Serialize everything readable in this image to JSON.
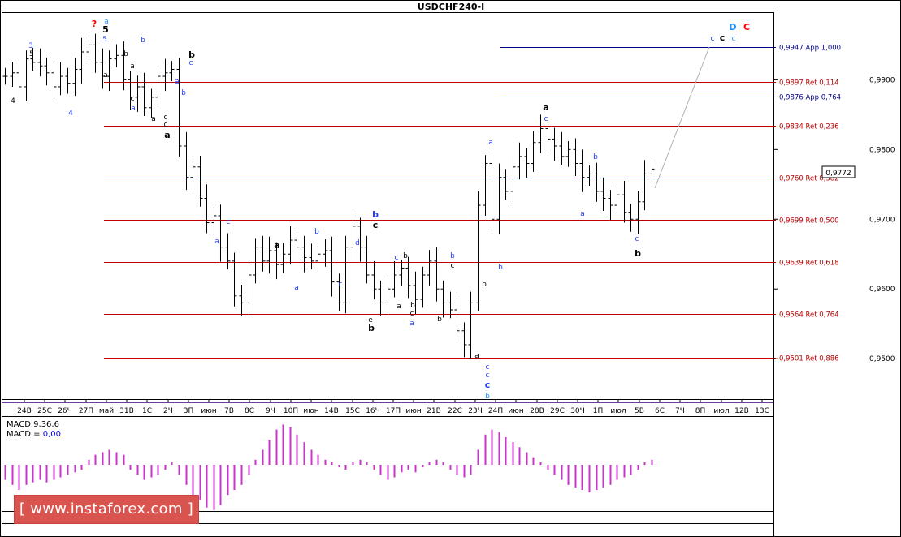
{
  "chart_data": {
    "type": "ohlc",
    "symbol": "USDCHF240-I",
    "ylim": [
      0.9442,
      0.9997
    ],
    "y_ticks": [
      "0,9900",
      "0,9800",
      "0,9700",
      "0,9600",
      "0,9500"
    ],
    "y_tick_values": [
      0.99,
      0.98,
      0.97,
      0.96,
      0.95
    ],
    "x_ticks": [
      "24В",
      "25С",
      "26Ч",
      "27П",
      "май",
      "31В",
      "1С",
      "2Ч",
      "3П",
      "июн",
      "7В",
      "8С",
      "9Ч",
      "10П",
      "июн",
      "14В",
      "15С",
      "16Ч",
      "17П",
      "июн",
      "21В",
      "22С",
      "23Ч",
      "24П",
      "июн",
      "28В",
      "29С",
      "30Ч",
      "1П",
      "июл",
      "5В",
      "6С",
      "7Ч",
      "8П",
      "июл",
      "12В",
      "13С"
    ],
    "current_price": "0,9772",
    "levels": [
      {
        "label": "0,9947 App 1,000",
        "value": 0.9947,
        "kind": "app",
        "color": "#00008b"
      },
      {
        "label": "0,9897 Ret 0,114",
        "value": 0.9897,
        "kind": "ret",
        "color": "#c00000"
      },
      {
        "label": "0,9876 App 0,764",
        "value": 0.9876,
        "kind": "app",
        "color": "#00008b"
      },
      {
        "label": "0,9834 Ret 0,236",
        "value": 0.9834,
        "kind": "ret",
        "color": "#c00000"
      },
      {
        "label": "0,9760 Ret 0,382",
        "value": 0.976,
        "kind": "ret",
        "color": "#c00000"
      },
      {
        "label": "0,9699 Ret 0,500",
        "value": 0.9699,
        "kind": "ret",
        "color": "#c00000"
      },
      {
        "label": "0,9639 Ret 0,618",
        "value": 0.9639,
        "kind": "ret",
        "color": "#c00000"
      },
      {
        "label": "0,9564 Ret 0,764",
        "value": 0.9564,
        "kind": "ret",
        "color": "#c00000"
      },
      {
        "label": "0,9501 Ret 0,886",
        "value": 0.9501,
        "kind": "ret",
        "color": "#c00000"
      }
    ],
    "wave_labels": [
      {
        "t": "?",
        "color": "#ff0000"
      },
      {
        "t": "a",
        "color": "#1e90ff"
      },
      {
        "t": "5",
        "color": "#000"
      },
      {
        "t": "5",
        "color": "#1e3cff"
      },
      {
        "t": "3",
        "color": "#1e3cff"
      },
      {
        "t": "5",
        "color": "#000"
      },
      {
        "t": "4",
        "color": "#000"
      },
      {
        "t": "4",
        "color": "#1e3cff"
      },
      {
        "t": "a",
        "color": "#000"
      },
      {
        "t": "b",
        "color": "#000"
      },
      {
        "t": "b",
        "color": "#1e3cff"
      },
      {
        "t": "a",
        "color": "#000"
      },
      {
        "t": "c",
        "color": "#000"
      },
      {
        "t": "a",
        "color": "#1e3cff"
      },
      {
        "t": "a",
        "color": "#000"
      },
      {
        "t": "c",
        "color": "#000"
      },
      {
        "t": "c",
        "color": "#000"
      },
      {
        "t": "a",
        "color": "#000"
      },
      {
        "t": "a",
        "color": "#1e3cff"
      },
      {
        "t": "b",
        "color": "#1e3cff"
      },
      {
        "t": "b",
        "color": "#000"
      },
      {
        "t": "c",
        "color": "#1e3cff"
      },
      {
        "t": "a",
        "color": "#1e3cff"
      },
      {
        "t": "c",
        "color": "#1e3cff"
      },
      {
        "t": "a",
        "color": "#000"
      },
      {
        "t": "a",
        "color": "#1e3cff"
      },
      {
        "t": "b",
        "color": "#1e3cff"
      },
      {
        "t": "c",
        "color": "#1e3cff"
      },
      {
        "t": "d",
        "color": "#1e3cff"
      },
      {
        "t": "e",
        "color": "#000"
      },
      {
        "t": "b",
        "color": "#000"
      },
      {
        "t": "b",
        "color": "#1e3cff"
      },
      {
        "t": "c",
        "color": "#000"
      },
      {
        "t": "b",
        "color": "#000"
      },
      {
        "t": "c",
        "color": "#1e3cff"
      },
      {
        "t": "a",
        "color": "#000"
      },
      {
        "t": "b",
        "color": "#000"
      },
      {
        "t": "c",
        "color": "#000"
      },
      {
        "t": "a",
        "color": "#1e3cff"
      },
      {
        "t": "b",
        "color": "#000"
      },
      {
        "t": "b",
        "color": "#1e3cff"
      },
      {
        "t": "c",
        "color": "#000"
      },
      {
        "t": "a",
        "color": "#000"
      },
      {
        "t": "c",
        "color": "#1e3cff"
      },
      {
        "t": "c",
        "color": "#1e3cff"
      },
      {
        "t": "c",
        "color": "#1e3cff"
      },
      {
        "t": "b",
        "color": "#1e90ff"
      },
      {
        "t": "b",
        "color": "#000"
      },
      {
        "t": "a",
        "color": "#1e3cff"
      },
      {
        "t": "b",
        "color": "#1e3cff"
      },
      {
        "t": "a",
        "color": "#000"
      },
      {
        "t": "c",
        "color": "#1e3cff"
      },
      {
        "t": "b",
        "color": "#1e3cff"
      },
      {
        "t": "a",
        "color": "#1e3cff"
      },
      {
        "t": "c",
        "color": "#1e3cff"
      },
      {
        "t": "b",
        "color": "#000"
      },
      {
        "t": "c",
        "color": "#1e3cff"
      },
      {
        "t": "c",
        "color": "#000"
      },
      {
        "t": "c",
        "color": "#1e90ff"
      },
      {
        "t": "D",
        "color": "#1e90ff"
      },
      {
        "t": "C",
        "color": "#ff0000"
      }
    ],
    "close_path": [
      0.9905,
      0.991,
      0.989,
      0.993,
      0.9925,
      0.992,
      0.991,
      0.989,
      0.9905,
      0.9895,
      0.9915,
      0.994,
      0.995,
      0.9925,
      0.9905,
      0.993,
      0.9935,
      0.99,
      0.9875,
      0.989,
      0.986,
      0.9875,
      0.9905,
      0.991,
      0.9915,
      0.9805,
      0.976,
      0.9775,
      0.973,
      0.9695,
      0.9705,
      0.966,
      0.964,
      0.959,
      0.958,
      0.962,
      0.966,
      0.964,
      0.9655,
      0.9635,
      0.965,
      0.967,
      0.966,
      0.9645,
      0.964,
      0.965,
      0.9655,
      0.961,
      0.958,
      0.966,
      0.969,
      0.966,
      0.962,
      0.96,
      0.958,
      0.96,
      0.962,
      0.963,
      0.9605,
      0.9585,
      0.962,
      0.964,
      0.96,
      0.958,
      0.957,
      0.954,
      0.952,
      0.958,
      0.972,
      0.978,
      0.97,
      0.976,
      0.974,
      0.9775,
      0.979,
      0.978,
      0.981,
      0.983,
      0.9815,
      0.9805,
      0.979,
      0.98,
      0.978,
      0.976,
      0.9765,
      0.974,
      0.973,
      0.972,
      0.9735,
      0.971,
      0.97,
      0.9725,
      0.9765,
      0.9772
    ],
    "macd": {
      "label": "MACD 9,36,6",
      "value_label": "MACD = ",
      "value": "0,00",
      "histogram": [
        -0.3,
        -0.4,
        -0.5,
        -0.4,
        -0.35,
        -0.3,
        -0.35,
        -0.3,
        -0.25,
        -0.2,
        -0.15,
        -0.1,
        0.1,
        0.2,
        0.25,
        0.3,
        0.25,
        0.2,
        -0.1,
        -0.2,
        -0.3,
        -0.25,
        -0.2,
        -0.1,
        0.05,
        -0.2,
        -0.4,
        -0.6,
        -0.7,
        -0.85,
        -0.9,
        -0.8,
        -0.6,
        -0.5,
        -0.4,
        -0.2,
        0.1,
        0.3,
        0.5,
        0.7,
        0.8,
        0.75,
        0.6,
        0.45,
        0.3,
        0.2,
        0.1,
        0.05,
        -0.05,
        -0.1,
        0.05,
        0.1,
        0.05,
        -0.1,
        -0.2,
        -0.3,
        -0.25,
        -0.15,
        -0.1,
        -0.15,
        -0.05,
        0.05,
        0.1,
        0.05,
        -0.1,
        -0.2,
        -0.25,
        -0.2,
        0.3,
        0.6,
        0.7,
        0.65,
        0.55,
        0.45,
        0.35,
        0.25,
        0.15,
        0.05,
        -0.1,
        -0.2,
        -0.3,
        -0.4,
        -0.45,
        -0.5,
        -0.55,
        -0.5,
        -0.45,
        -0.4,
        -0.3,
        -0.25,
        -0.2,
        -0.1,
        0.05,
        0.1
      ],
      "color": "#cc33cc",
      "label_color": "#0000ff"
    }
  },
  "watermark": "[ www.instaforex.com ]"
}
